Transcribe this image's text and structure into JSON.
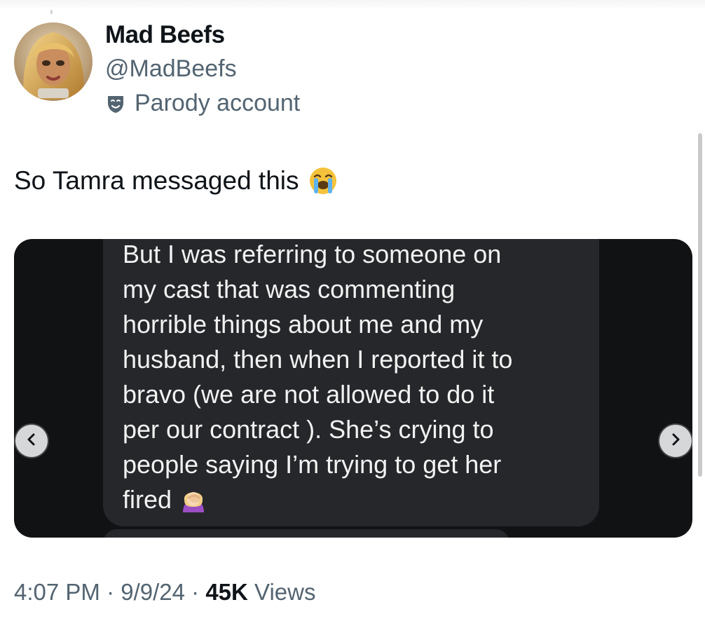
{
  "author": {
    "display_name": "Mad Beefs",
    "handle": "@MadBeefs",
    "badge_label": "Parody account",
    "badge_icon": "theater-mask-icon"
  },
  "tweet": {
    "text": "So Tamra messaged this",
    "emoji": "loudly-crying-face-emoji"
  },
  "media": {
    "message_text": "But I was referring to someone on\nmy cast that was commenting\nhorrible things about me and my\nhusband,  then when I reported it to\nbravo (we are not allowed to do it\nper our contract ).   She’s crying to\npeople saying I’m trying to get her\nfired",
    "message_emoji": "woman-facepalming-emoji",
    "prev_icon": "chevron-left-icon",
    "next_icon": "chevron-right-icon"
  },
  "meta": {
    "time": "4:07 PM",
    "separator": " · ",
    "date": "9/9/24",
    "views_count": "45K",
    "views_label": " Views"
  },
  "colors": {
    "primary_text": "#0f1419",
    "secondary_text": "#536471",
    "media_bg": "#111214",
    "bubble_bg": "#26272b"
  }
}
